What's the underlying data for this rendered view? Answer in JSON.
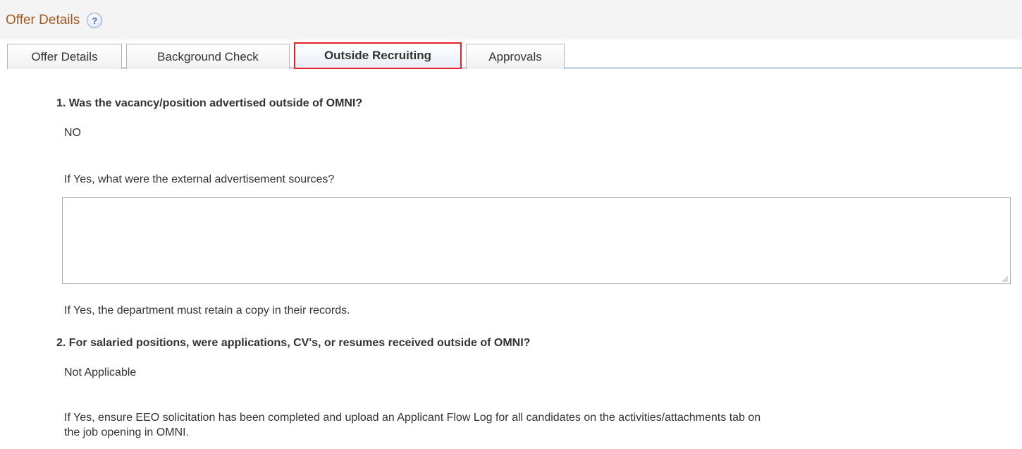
{
  "header": {
    "title": "Offer Details",
    "help_icon": "help-question-icon",
    "help_glyph": "?"
  },
  "tabs": [
    {
      "label": "Offer Details",
      "active": false
    },
    {
      "label": "Background Check",
      "active": false
    },
    {
      "label": "Outside Recruiting",
      "active": true
    },
    {
      "label": "Approvals",
      "active": false
    }
  ],
  "section1": {
    "question": "1. Was the vacancy/position advertised outside of OMNI?",
    "answer": "NO",
    "sources_label": "If Yes, what were the external advertisement sources?",
    "sources_value": "",
    "retain_note": "If Yes, the department must retain a copy in their records."
  },
  "section2": {
    "question": "2. For salaried positions, were applications, CV's, or resumes received outside of OMNI?",
    "answer": "Not Applicable",
    "note": "If Yes, ensure EEO solicitation has been completed and upload an Applicant Flow Log for all candidates on the activities/attachments tab on the job opening in OMNI."
  },
  "colors": {
    "title": "#a35a1e",
    "active_tab_highlight": "#e8202a",
    "text": "#333333"
  }
}
